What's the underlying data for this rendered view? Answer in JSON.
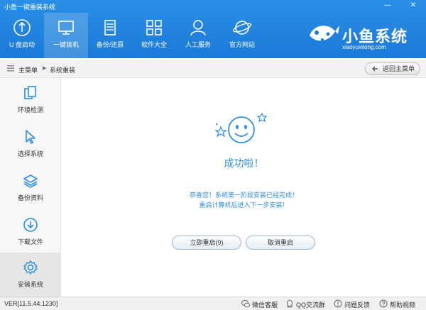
{
  "window": {
    "title": "小鱼一键重装系统",
    "min_glyph": "—",
    "close_glyph": "✕"
  },
  "nav": [
    {
      "label": "U 盘启动",
      "icon": "usb-icon"
    },
    {
      "label": "一键装机",
      "icon": "monitor-icon"
    },
    {
      "label": "备份/还原",
      "icon": "server-icon"
    },
    {
      "label": "软件大全",
      "icon": "grid-icon"
    },
    {
      "label": "人工服务",
      "icon": "user-icon"
    },
    {
      "label": "官方网站",
      "icon": "planet-icon"
    }
  ],
  "brand": {
    "name": "小鱼系统",
    "url": "xiaoyuxitong.com"
  },
  "breadcrumb": {
    "home": "主菜单",
    "current": "系统重装",
    "back_label": "返回主菜单"
  },
  "sidebar": [
    {
      "label": "环境检测",
      "icon": "copy-icon"
    },
    {
      "label": "选择系统",
      "icon": "cursor-icon"
    },
    {
      "label": "备份资料",
      "icon": "layers-icon"
    },
    {
      "label": "下载文件",
      "icon": "download-icon"
    },
    {
      "label": "安装系统",
      "icon": "gear-icon"
    }
  ],
  "main": {
    "title": "成功啦！",
    "line1": "恭喜您！系统第一阶段安装已经完成！",
    "line2": "重启计算机后进入下一步安装！",
    "restart_label": "立即重启(9)",
    "cancel_label": "取消重启"
  },
  "status": {
    "version": "VER[11.5.44.1230]",
    "wechat": "微信客服",
    "qq": "QQ交流群",
    "feedback": "问题反馈",
    "help": "帮助视频"
  },
  "colors": {
    "accent": "#2a8fe6",
    "header_top": "#2a8fe6",
    "header_bottom": "#1b7ad8"
  }
}
